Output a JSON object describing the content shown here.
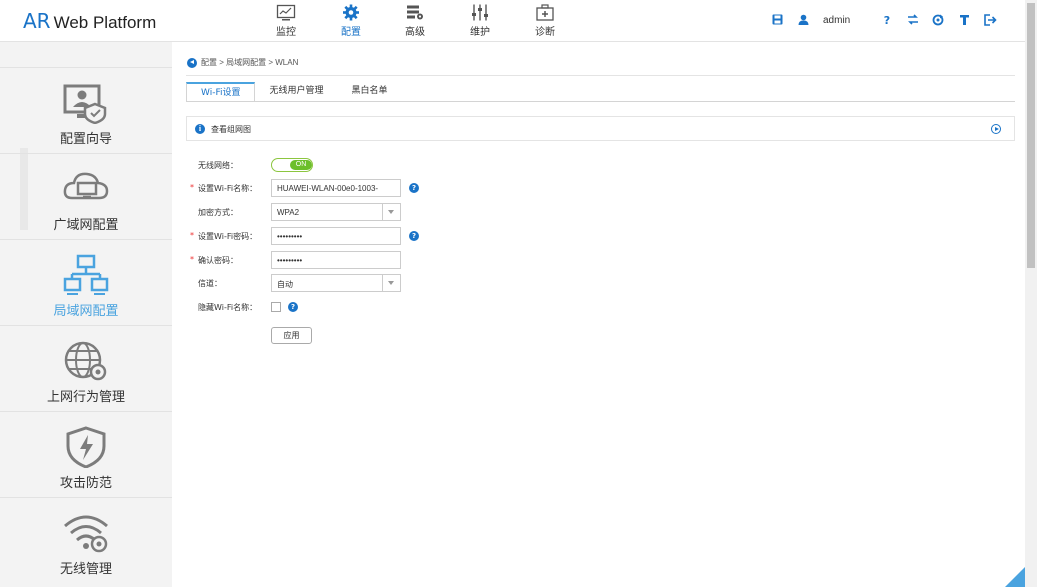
{
  "header": {
    "logo_ar": "AR",
    "logo_text": "Web Platform",
    "nav": [
      {
        "label": "监控",
        "icon": "monitor-icon"
      },
      {
        "label": "配置",
        "icon": "gear-icon",
        "active": true
      },
      {
        "label": "高级",
        "icon": "advanced-icon"
      },
      {
        "label": "维护",
        "icon": "sliders-icon"
      },
      {
        "label": "诊断",
        "icon": "medkit-icon"
      }
    ],
    "user": "admin",
    "accent": "#1a73c7"
  },
  "sidebar": {
    "items": [
      {
        "label": "配置向导",
        "icon": "wizard-icon"
      },
      {
        "label": "广域网配置",
        "icon": "cloud-icon"
      },
      {
        "label": "局域网配置",
        "icon": "network-icon",
        "active": true
      },
      {
        "label": "上网行为管理",
        "icon": "globe-gear-icon"
      },
      {
        "label": "攻击防范",
        "icon": "shield-icon"
      },
      {
        "label": "无线管理",
        "icon": "wifi-gear-icon"
      }
    ]
  },
  "breadcrumb": {
    "text": "配置 > 局域网配置 > WLAN"
  },
  "tabs": [
    {
      "label": "Wi-Fi设置",
      "active": true
    },
    {
      "label": "无线用户管理"
    },
    {
      "label": "黑白名单"
    }
  ],
  "info": {
    "text": "查看组网图"
  },
  "form": {
    "wireless_label": "无线网络：",
    "wireless_state": "ON",
    "ssid_label": "设置Wi-Fi名称：",
    "ssid_value": "HUAWEI-WLAN-00e0-1003-",
    "encrypt_label": "加密方式：",
    "encrypt_value": "WPA2",
    "password_label": "设置Wi-Fi密码：",
    "password_value": "•••••••••",
    "confirm_label": "确认密码：",
    "confirm_value": "•••••••••",
    "channel_label": "信道：",
    "channel_value": "自动",
    "hide_label": "隐藏Wi-Fi名称：",
    "hide_checked": false,
    "apply_label": "应用"
  }
}
